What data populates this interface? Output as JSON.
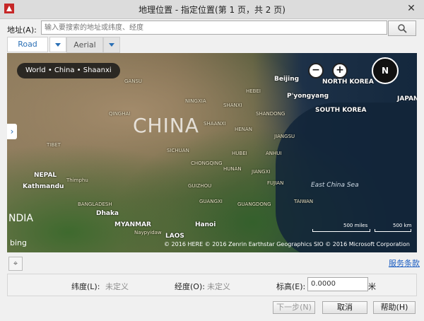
{
  "window": {
    "title": "地理位置 - 指定位置(第 1 页，共 2 页)",
    "close_glyph": "✕"
  },
  "address": {
    "label": "地址(A):",
    "placeholder": "输入要搜索的地址或纬度、经度"
  },
  "tabs": {
    "road": "Road",
    "aerial": "Aerial"
  },
  "map": {
    "breadcrumb": "World • China • Shaanxi",
    "country_label": "CHINA",
    "india_label": "NDIA",
    "sea_label": "East China Sea",
    "compass_label": "N",
    "zoom_out": "−",
    "zoom_in": "+",
    "side_toggle": "›",
    "places": [
      {
        "name": "Beijing",
        "cls": "big"
      },
      {
        "name": "NORTH KOREA",
        "cls": "big"
      },
      {
        "name": "P'yongyang",
        "cls": "big"
      },
      {
        "name": "SOUTH KOREA",
        "cls": "big"
      },
      {
        "name": "JAPAN",
        "cls": "big"
      },
      {
        "name": "SHANDONG",
        "cls": "dim"
      },
      {
        "name": "HENAN",
        "cls": "dim"
      },
      {
        "name": "JIANGSU",
        "cls": "dim"
      },
      {
        "name": "SICHUAN",
        "cls": "dim"
      },
      {
        "name": "HUBEI",
        "cls": "dim"
      },
      {
        "name": "ANHUI",
        "cls": "dim"
      },
      {
        "name": "CHONGQING",
        "cls": "dim"
      },
      {
        "name": "HUNAN",
        "cls": "dim"
      },
      {
        "name": "JIANGXI",
        "cls": "dim"
      },
      {
        "name": "FUJIAN",
        "cls": "dim"
      },
      {
        "name": "GUIZHOU",
        "cls": "dim"
      },
      {
        "name": "GUANGXI",
        "cls": "dim"
      },
      {
        "name": "GUANGDONG",
        "cls": "dim"
      },
      {
        "name": "TIBET",
        "cls": "dim"
      },
      {
        "name": "QINGHAI",
        "cls": "dim"
      },
      {
        "name": "GANSU",
        "cls": "dim"
      },
      {
        "name": "NINGXIA",
        "cls": "dim"
      },
      {
        "name": "SHAANXI",
        "cls": "dim"
      },
      {
        "name": "SHANXI",
        "cls": "dim"
      },
      {
        "name": "HEBEI",
        "cls": "dim"
      },
      {
        "name": "NEPAL",
        "cls": "big"
      },
      {
        "name": "Kathmandu",
        "cls": "big"
      },
      {
        "name": "Thimphu",
        "cls": "dim"
      },
      {
        "name": "BANGLADESH",
        "cls": "dim"
      },
      {
        "name": "Dhaka",
        "cls": "big"
      },
      {
        "name": "MYANMAR",
        "cls": "big"
      },
      {
        "name": "Naypyidaw",
        "cls": "dim"
      },
      {
        "name": "LAOS",
        "cls": "big"
      },
      {
        "name": "Hanoi",
        "cls": "big"
      },
      {
        "name": "TAIWAN",
        "cls": "dim"
      }
    ],
    "scale_miles": "500 miles",
    "scale_km": "500 km",
    "bing_label": "bing",
    "copyright": "© 2016 HERE   © 2016 Zenrin   Earthstar Geographics SIO   © 2016 Microsoft Corporation"
  },
  "service_link": "服务条款",
  "locate_glyph": "⌖",
  "coords": {
    "lat_label": "纬度(L):",
    "lat_value": "未定义",
    "lon_label": "经度(O):",
    "lon_value": "未定义",
    "elev_label": "标高(E):",
    "elev_value": "0.0000",
    "elev_unit": "米"
  },
  "buttons": {
    "next": "下一步(N)",
    "cancel": "取消",
    "help": "帮助(H)"
  }
}
